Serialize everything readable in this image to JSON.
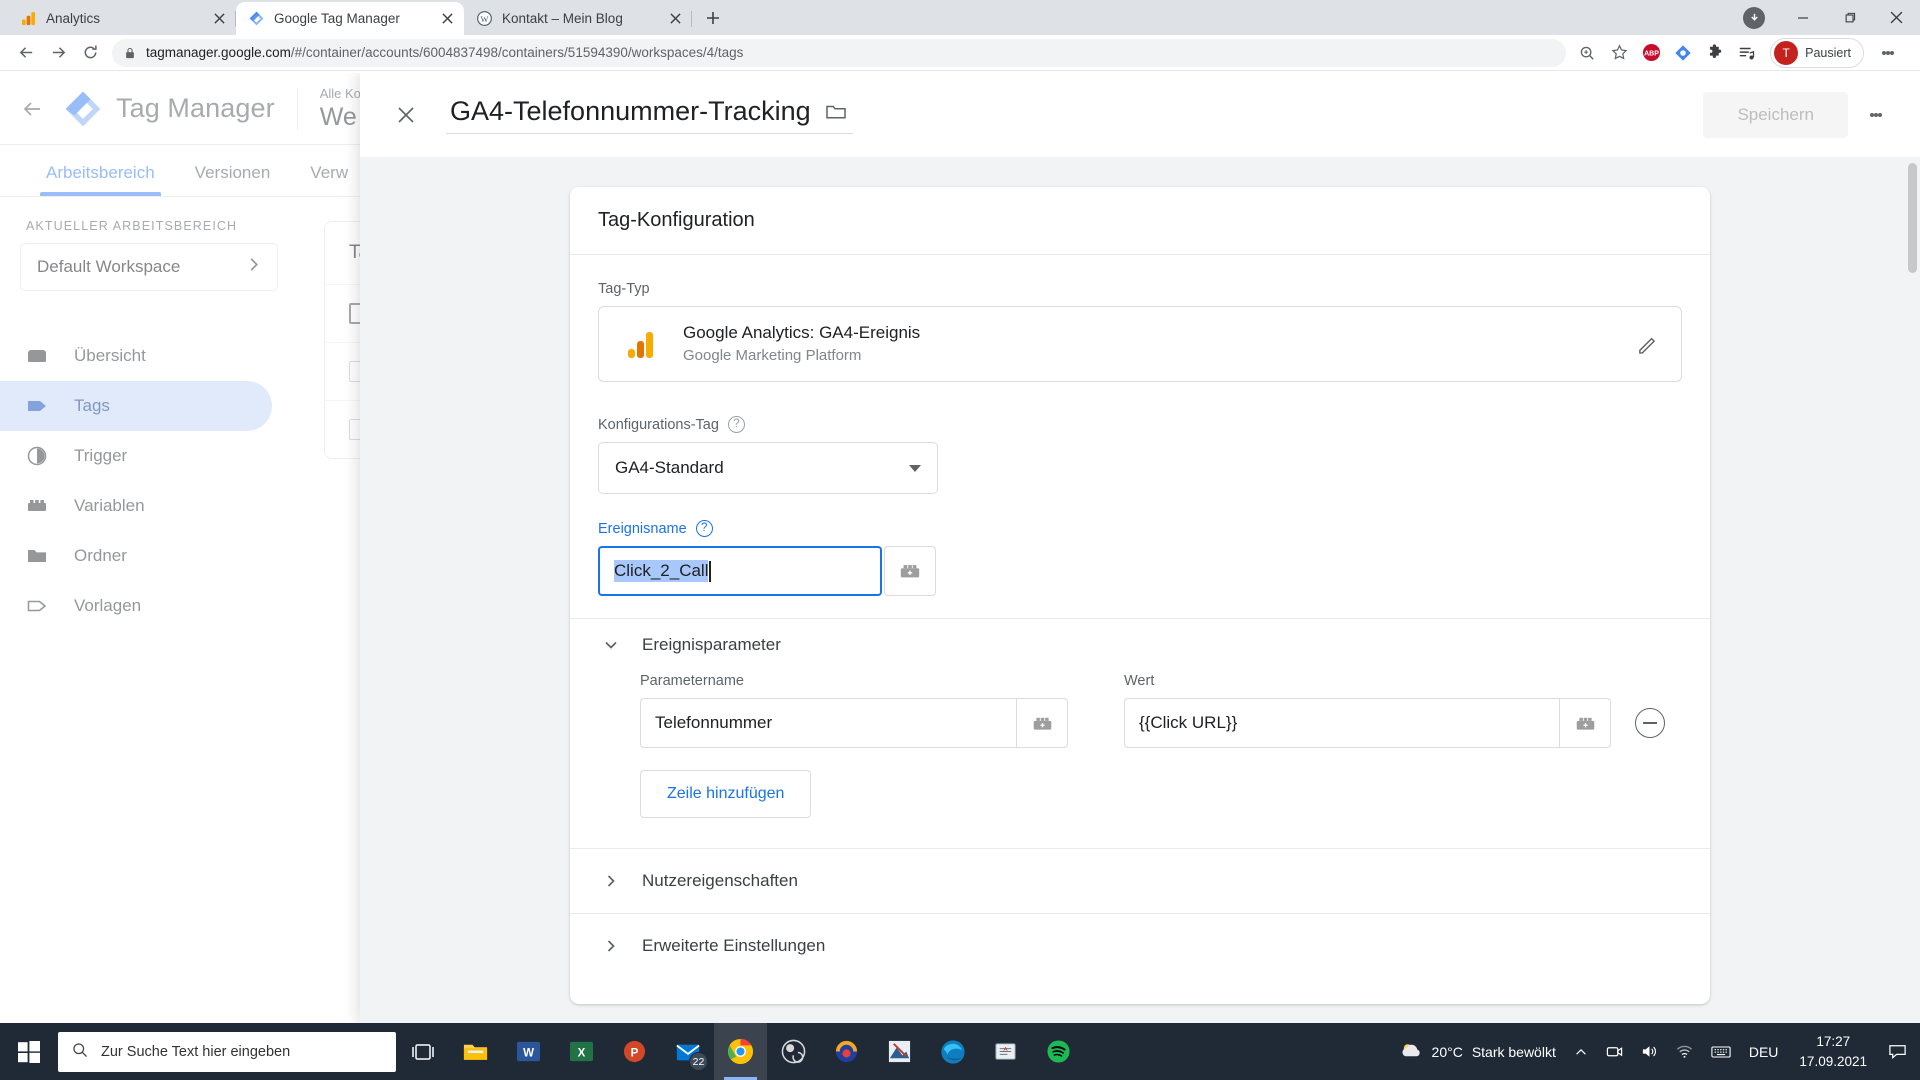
{
  "browser": {
    "tabs": [
      {
        "title": "Analytics",
        "favicon": "analytics-icon",
        "active": false
      },
      {
        "title": "Google Tag Manager",
        "favicon": "tag-manager-icon",
        "active": true
      },
      {
        "title": "Kontakt – Mein Blog",
        "favicon": "wordpress-icon",
        "active": false
      }
    ],
    "newtab_label": "+",
    "window_controls": {
      "minimize": "–",
      "maximize": "❐",
      "close": "✕"
    },
    "url": {
      "host": "tagmanager.google.com",
      "path": "/#/container/accounts/6004837498/containers/51594390/workspaces/4/tags",
      "full": "tagmanager.google.com/#/container/accounts/6004837498/containers/51594390/workspaces/4/tags"
    },
    "toolbar_icons": [
      "zoom-icon",
      "bookmark-star-icon",
      "adblock-plus-icon",
      "tag-assistant-icon",
      "extensions-puzzle-icon",
      "reading-list-icon"
    ],
    "profile": {
      "initial": "T",
      "label": "Pausiert"
    },
    "menu_icon": "chrome-menu-icon"
  },
  "gtm": {
    "brand": "Tag Manager",
    "account_caption": "Alle Ko",
    "account_name": "We",
    "tabs": [
      {
        "label": "Arbeitsbereich",
        "selected": true
      },
      {
        "label": "Versionen",
        "selected": false
      },
      {
        "label": "Verw",
        "selected": false
      }
    ],
    "sidebar": {
      "caption": "AKTUELLER ARBEITSBEREICH",
      "workspace": "Default Workspace",
      "items": [
        {
          "label": "Übersicht",
          "icon": "overview-icon",
          "selected": false
        },
        {
          "label": "Tags",
          "icon": "tag-icon",
          "selected": true
        },
        {
          "label": "Trigger",
          "icon": "trigger-icon",
          "selected": false
        },
        {
          "label": "Variablen",
          "icon": "variables-icon",
          "selected": false
        },
        {
          "label": "Ordner",
          "icon": "folder-icon",
          "selected": false
        },
        {
          "label": "Vorlagen",
          "icon": "templates-icon",
          "selected": false
        }
      ]
    },
    "tags_table_header": "Tag"
  },
  "panel": {
    "close_label": "✕",
    "title": "GA4-Telefonnummer-Tracking",
    "folder_icon": "folder-icon",
    "save_label": "Speichern",
    "overflow_icon": "kebab-menu-icon",
    "card": {
      "header": "Tag-Konfiguration",
      "tag_type_label": "Tag-Typ",
      "tag_type": {
        "title": "Google Analytics: GA4-Ereignis",
        "subtitle": "Google Marketing Platform",
        "icon": "google-analytics-icon",
        "edit_icon": "pencil-icon"
      },
      "config_tag_label": "Konfigurations-Tag",
      "config_tag_value": "GA4-Standard",
      "event_name_label": "Ereignisname",
      "event_name_value": "Click_2_Call",
      "event_params": {
        "section_label": "Ereignisparameter",
        "expanded": true,
        "columns": [
          "Parametername",
          "Wert"
        ],
        "rows": [
          {
            "name": "Telefonnummer",
            "value": "{{Click URL}}"
          }
        ],
        "add_row_label": "Zeile hinzufügen",
        "remove_icon": "minus-circle-icon"
      },
      "sections": [
        {
          "label": "Nutzereigenschaften",
          "expanded": false
        },
        {
          "label": "Erweiterte Einstellungen",
          "expanded": false
        }
      ]
    }
  },
  "taskbar": {
    "start_icon": "windows-start-icon",
    "search_placeholder": "Zur Suche Text hier eingeben",
    "search_icon": "search-icon",
    "taskview_icon": "task-view-icon",
    "apps": [
      {
        "name": "file-explorer-icon",
        "badge": ""
      },
      {
        "name": "word-icon",
        "badge": ""
      },
      {
        "name": "excel-icon",
        "badge": ""
      },
      {
        "name": "powerpoint-icon",
        "badge": ""
      },
      {
        "name": "mail-icon",
        "badge": "22"
      },
      {
        "name": "chrome-icon",
        "badge": ""
      },
      {
        "name": "obs-icon",
        "badge": ""
      },
      {
        "name": "audacity-icon",
        "badge": ""
      },
      {
        "name": "photoshop-icon",
        "badge": ""
      },
      {
        "name": "edge-icon",
        "badge": ""
      },
      {
        "name": "notepad-icon",
        "badge": ""
      },
      {
        "name": "spotify-icon",
        "badge": ""
      }
    ],
    "weather_temp": "20°C",
    "weather_desc": "Stark bewölkt",
    "tray_icons": [
      "chevron-up-icon",
      "camera-icon",
      "volume-icon",
      "wifi-icon",
      "keyboard-icon"
    ],
    "language": "DEU",
    "time": "17:27",
    "date": "17.09.2021",
    "notification_icon": "notification-icon"
  },
  "colors": {
    "accent_blue": "#1a73e8",
    "gtm_blue": "#4285f4",
    "selection_blue": "#a8c7fa",
    "sidebar_sel": "#c6d8f7",
    "analytics_orange": "#f9ab00",
    "taskbar": "#1f2a36"
  }
}
